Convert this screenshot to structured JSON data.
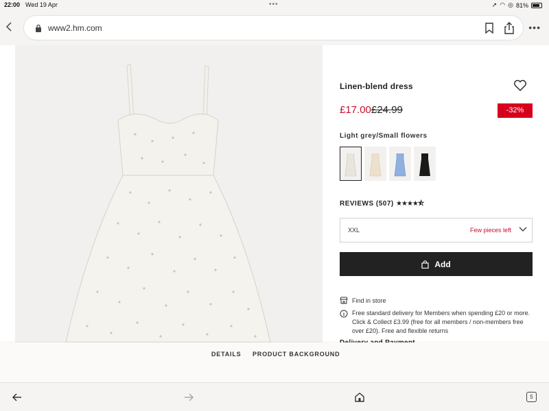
{
  "status_bar": {
    "time": "22:00",
    "date": "Wed 19 Apr",
    "battery": "81%"
  },
  "browser": {
    "url": "www2.hm.com",
    "more_label": "•••"
  },
  "product": {
    "title": "Linen-blend dress",
    "sale_price": "£17.00",
    "original_price": "£24.99",
    "discount": "-32%",
    "color_name": "Light grey/Small flowers",
    "swatches": [
      {
        "name": "light-grey-small-flowers",
        "color": "#e8e5dc",
        "selected": true
      },
      {
        "name": "beige-floral",
        "color": "#ede0cc",
        "selected": false
      },
      {
        "name": "blue-floral",
        "color": "#8fb0e0",
        "selected": false
      },
      {
        "name": "black",
        "color": "#1a1a1a",
        "selected": false
      }
    ],
    "reviews_label": "REVIEWS (507)",
    "rating": 4.5,
    "stars": "★★★★⯪",
    "size": {
      "value": "XXL",
      "stock": "Few pieces left"
    },
    "add_label": "Add",
    "find_store": "Find in store",
    "delivery_text": "Free standard delivery for Members when spending £20 or more. Click & Collect £3.99 (free for all members / non-members free over £20). Free and flexible returns",
    "delivery_heading": "Delivery and Payment"
  },
  "tabs": {
    "details": "DETAILS",
    "background": "PRODUCT BACKGROUND"
  },
  "toolbar": {
    "tab_count": "5"
  },
  "colors": {
    "sale": "#c8102e",
    "discount_bg": "#d6001c",
    "add_button_bg": "#222222"
  }
}
